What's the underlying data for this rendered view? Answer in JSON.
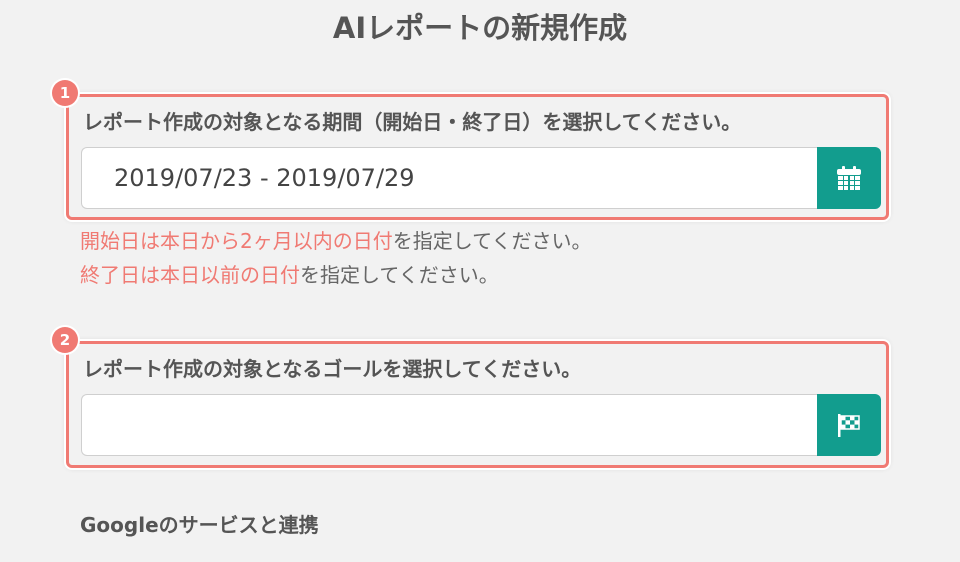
{
  "page": {
    "title": "AIレポートの新規作成"
  },
  "step1": {
    "badge": "1",
    "label": "レポート作成の対象となる期間（開始日・終了日）を選択してください。",
    "date_range_value": "2019/07/23 - 2019/07/29",
    "button_icon": "calendar-icon",
    "hints": [
      {
        "emphasis": "開始日は本日から2ヶ月以内の日付",
        "rest": "を指定してください。"
      },
      {
        "emphasis": "終了日は本日以前の日付",
        "rest": "を指定してください。"
      }
    ]
  },
  "step2": {
    "badge": "2",
    "label": "レポート作成の対象となるゴールを選択してください。",
    "goal_value": "",
    "button_icon": "checkered-flag-icon"
  },
  "google_section": {
    "title": "Googleのサービスと連携"
  },
  "colors": {
    "accent_red": "#f07a73",
    "button_teal": "#129d8e",
    "background": "#f2f2f2",
    "text": "#555555"
  }
}
